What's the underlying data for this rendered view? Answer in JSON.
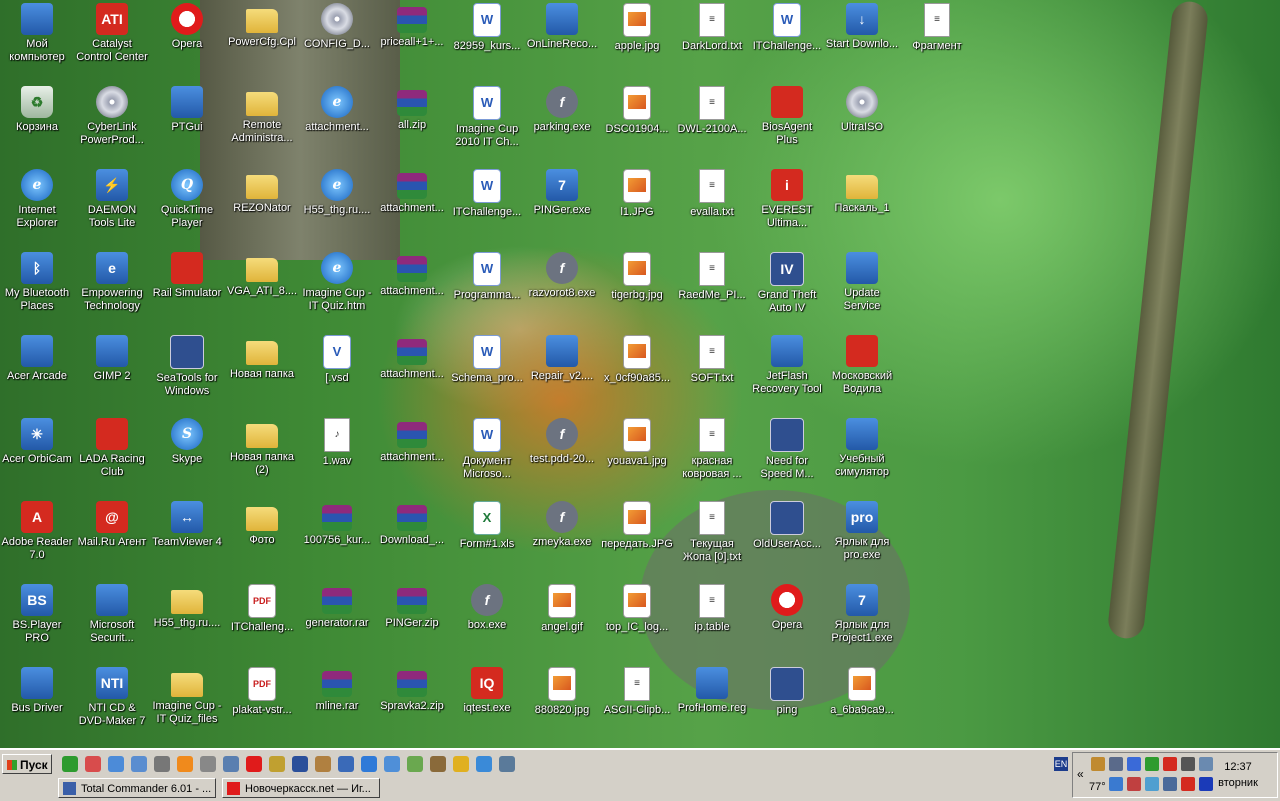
{
  "desktop_icons": [
    {
      "label": "Мой компьютер",
      "icon": "my-computer-icon",
      "kind": "app",
      "col": 0,
      "row": 0
    },
    {
      "label": "Catalyst Control Center",
      "icon": "ati-icon",
      "kind": "red",
      "col": 1,
      "row": 0,
      "glyph": "ATI"
    },
    {
      "label": "Opera",
      "icon": "opera-icon",
      "kind": "opera",
      "col": 2,
      "row": 0
    },
    {
      "label": "PowerCfg.Cpl",
      "icon": "folder-icon",
      "kind": "folder",
      "col": 3,
      "row": 0
    },
    {
      "label": "CONFIG_D...",
      "icon": "cd-icon",
      "kind": "cd",
      "col": 4,
      "row": 0
    },
    {
      "label": "priceall+1+...",
      "icon": "archive-icon",
      "kind": "zip",
      "col": 5,
      "row": 0
    },
    {
      "label": "82959_kurs...",
      "icon": "word-document-icon",
      "kind": "word",
      "col": 6,
      "row": 0,
      "glyph": "W"
    },
    {
      "label": "OnLineReco...",
      "icon": "app-icon",
      "kind": "app",
      "col": 7,
      "row": 0
    },
    {
      "label": "apple.jpg",
      "icon": "image-file-icon",
      "kind": "img",
      "col": 8,
      "row": 0
    },
    {
      "label": "DarkLord.txt",
      "icon": "text-file-icon",
      "kind": "doc",
      "col": 9,
      "row": 0,
      "glyph": "≡"
    },
    {
      "label": "ITChallenge...",
      "icon": "word-document-icon",
      "kind": "word",
      "col": 10,
      "row": 0,
      "glyph": "W"
    },
    {
      "label": "Start Downlo...",
      "icon": "download-icon",
      "kind": "app",
      "col": 11,
      "row": 0,
      "glyph": "↓"
    },
    {
      "label": "Фрагмент",
      "icon": "text-file-icon",
      "kind": "doc",
      "col": 12,
      "row": 0,
      "glyph": "≡"
    },
    {
      "label": "Корзина",
      "icon": "recycle-bin-icon",
      "kind": "recycle",
      "col": 0,
      "row": 1,
      "glyph": "♻"
    },
    {
      "label": "CyberLink PowerProd...",
      "icon": "cd-icon",
      "kind": "cd",
      "col": 1,
      "row": 1
    },
    {
      "label": "PTGui",
      "icon": "app-icon",
      "kind": "app",
      "col": 2,
      "row": 1
    },
    {
      "label": "Remote Administra...",
      "icon": "folder-icon",
      "kind": "folder",
      "col": 3,
      "row": 1
    },
    {
      "label": "attachment...",
      "icon": "internet-explorer-icon",
      "kind": "ie",
      "col": 4,
      "row": 1,
      "glyph": "e"
    },
    {
      "label": "all.zip",
      "icon": "archive-icon",
      "kind": "zip",
      "col": 5,
      "row": 1
    },
    {
      "label": "Imagine Cup 2010 IT Ch...",
      "icon": "word-document-icon",
      "kind": "word",
      "col": 6,
      "row": 1,
      "glyph": "W"
    },
    {
      "label": "parking.exe",
      "icon": "flash-icon",
      "kind": "flash",
      "col": 7,
      "row": 1,
      "glyph": "f"
    },
    {
      "label": "DSC01904...",
      "icon": "image-file-icon",
      "kind": "img",
      "col": 8,
      "row": 1
    },
    {
      "label": "DWL-2100A...",
      "icon": "text-file-icon",
      "kind": "doc",
      "col": 9,
      "row": 1,
      "glyph": "≡"
    },
    {
      "label": "BiosAgent Plus",
      "icon": "app-icon",
      "kind": "red",
      "col": 10,
      "row": 1
    },
    {
      "label": "UltraISO",
      "icon": "cd-icon",
      "kind": "cd",
      "col": 11,
      "row": 1
    },
    {
      "label": "Internet Explorer",
      "icon": "internet-explorer-icon",
      "kind": "ie",
      "col": 0,
      "row": 2,
      "glyph": "e"
    },
    {
      "label": "DAEMON Tools Lite",
      "icon": "daemon-tools-icon",
      "kind": "app",
      "col": 1,
      "row": 2,
      "glyph": "⚡"
    },
    {
      "label": "QuickTime Player",
      "icon": "quicktime-icon",
      "kind": "ie",
      "col": 2,
      "row": 2,
      "glyph": "Q"
    },
    {
      "label": "REZONator",
      "icon": "folder-icon",
      "kind": "folder",
      "col": 3,
      "row": 2
    },
    {
      "label": "H55_thg.ru....",
      "icon": "internet-explorer-icon",
      "kind": "ie",
      "col": 4,
      "row": 2,
      "glyph": "e"
    },
    {
      "label": "attachment...",
      "icon": "archive-icon",
      "kind": "zip",
      "col": 5,
      "row": 2
    },
    {
      "label": "ITChallenge...",
      "icon": "word-document-icon",
      "kind": "word",
      "col": 6,
      "row": 2,
      "glyph": "W"
    },
    {
      "label": "PINGer.exe",
      "icon": "app-icon",
      "kind": "app",
      "col": 7,
      "row": 2,
      "glyph": "7"
    },
    {
      "label": "l1.JPG",
      "icon": "image-file-icon",
      "kind": "img",
      "col": 8,
      "row": 2
    },
    {
      "label": "evalla.txt",
      "icon": "text-file-icon",
      "kind": "doc",
      "col": 9,
      "row": 2,
      "glyph": "≡"
    },
    {
      "label": "EVEREST Ultima...",
      "icon": "info-icon",
      "kind": "red",
      "col": 10,
      "row": 2,
      "glyph": "i"
    },
    {
      "label": "Паскаль_1",
      "icon": "folder-icon",
      "kind": "folder",
      "col": 11,
      "row": 2
    },
    {
      "label": "My Bluetooth Places",
      "icon": "bluetooth-icon",
      "kind": "app",
      "col": 0,
      "row": 3,
      "glyph": "ᛒ"
    },
    {
      "label": "Empowering Technology",
      "icon": "app-icon",
      "kind": "app",
      "col": 1,
      "row": 3,
      "glyph": "e"
    },
    {
      "label": "Rail Simulator",
      "icon": "app-icon",
      "kind": "red",
      "col": 2,
      "row": 3
    },
    {
      "label": "VGA_ATI_8....",
      "icon": "folder-icon",
      "kind": "folder",
      "col": 3,
      "row": 3
    },
    {
      "label": "Imagine Cup - IT Quiz.htm",
      "icon": "internet-explorer-icon",
      "kind": "ie",
      "col": 4,
      "row": 3,
      "glyph": "e"
    },
    {
      "label": "attachment...",
      "icon": "archive-icon",
      "kind": "zip",
      "col": 5,
      "row": 3
    },
    {
      "label": "Programma...",
      "icon": "word-document-icon",
      "kind": "word",
      "col": 6,
      "row": 3,
      "glyph": "W"
    },
    {
      "label": "razvorot8.exe",
      "icon": "flash-icon",
      "kind": "flash",
      "col": 7,
      "row": 3,
      "glyph": "f"
    },
    {
      "label": "tigerbg.jpg",
      "icon": "image-file-icon",
      "kind": "img",
      "col": 8,
      "row": 3
    },
    {
      "label": "RaedMe_PI...",
      "icon": "text-file-icon",
      "kind": "doc",
      "col": 9,
      "row": 3,
      "glyph": "≡"
    },
    {
      "label": "Grand Theft Auto IV",
      "icon": "gta-icon",
      "kind": "win",
      "col": 10,
      "row": 3,
      "glyph": "IV"
    },
    {
      "label": "Update Service",
      "icon": "app-icon",
      "kind": "app",
      "col": 11,
      "row": 3
    },
    {
      "label": "Acer Arcade",
      "icon": "app-icon",
      "kind": "app",
      "col": 0,
      "row": 4
    },
    {
      "label": "GIMP 2",
      "icon": "gimp-icon",
      "kind": "app",
      "col": 1,
      "row": 4
    },
    {
      "label": "SeaTools for Windows",
      "icon": "app-icon",
      "kind": "win",
      "col": 2,
      "row": 4
    },
    {
      "label": "Новая папка",
      "icon": "folder-icon",
      "kind": "folder",
      "col": 3,
      "row": 4
    },
    {
      "label": "[.vsd",
      "icon": "visio-file-icon",
      "kind": "word",
      "col": 4,
      "row": 4,
      "glyph": "V"
    },
    {
      "label": "attachment...",
      "icon": "archive-icon",
      "kind": "zip",
      "col": 5,
      "row": 4
    },
    {
      "label": "Schema_pro...",
      "icon": "word-document-icon",
      "kind": "word",
      "col": 6,
      "row": 4,
      "glyph": "W"
    },
    {
      "label": "Repair_v2....",
      "icon": "app-icon",
      "kind": "app",
      "col": 7,
      "row": 4
    },
    {
      "label": "x_0cf90a85...",
      "icon": "image-file-icon",
      "kind": "img",
      "col": 8,
      "row": 4
    },
    {
      "label": "SOFT.txt",
      "icon": "text-file-icon",
      "kind": "doc",
      "col": 9,
      "row": 4,
      "glyph": "≡"
    },
    {
      "label": "JetFlash Recovery Tool",
      "icon": "app-icon",
      "kind": "app",
      "col": 10,
      "row": 4
    },
    {
      "label": "Московский Водила",
      "icon": "car-icon",
      "kind": "red",
      "col": 11,
      "row": 4
    },
    {
      "label": "Acer OrbiCam",
      "icon": "app-icon",
      "kind": "app",
      "col": 0,
      "row": 5,
      "glyph": "✳"
    },
    {
      "label": "LADA Racing Club",
      "icon": "app-icon",
      "kind": "red",
      "col": 1,
      "row": 5
    },
    {
      "label": "Skype",
      "icon": "skype-icon",
      "kind": "ie",
      "col": 2,
      "row": 5,
      "glyph": "S"
    },
    {
      "label": "Новая папка (2)",
      "icon": "folder-icon",
      "kind": "folder",
      "col": 3,
      "row": 5
    },
    {
      "label": "1.wav",
      "icon": "audio-file-icon",
      "kind": "doc",
      "col": 4,
      "row": 5,
      "glyph": "♪"
    },
    {
      "label": "attachment...",
      "icon": "archive-icon",
      "kind": "zip",
      "col": 5,
      "row": 5
    },
    {
      "label": "Документ Microso...",
      "icon": "word-document-icon",
      "kind": "word",
      "col": 6,
      "row": 5,
      "glyph": "W"
    },
    {
      "label": "test.pdd-20...",
      "icon": "flash-icon",
      "kind": "flash",
      "col": 7,
      "row": 5,
      "glyph": "f"
    },
    {
      "label": "youava1.jpg",
      "icon": "image-file-icon",
      "kind": "img",
      "col": 8,
      "row": 5
    },
    {
      "label": "красная ковровая ...",
      "icon": "text-file-icon",
      "kind": "doc",
      "col": 9,
      "row": 5,
      "glyph": "≡"
    },
    {
      "label": "Need for Speed M...",
      "icon": "app-icon",
      "kind": "win",
      "col": 10,
      "row": 5
    },
    {
      "label": "Учебный симулятор",
      "icon": "app-icon",
      "kind": "app",
      "col": 11,
      "row": 5
    },
    {
      "label": "Adobe Reader 7.0",
      "icon": "adobe-reader-icon",
      "kind": "red",
      "col": 0,
      "row": 6,
      "glyph": "A"
    },
    {
      "label": "Mail.Ru Агент",
      "icon": "mail-agent-icon",
      "kind": "red",
      "col": 1,
      "row": 6,
      "glyph": "@"
    },
    {
      "label": "TeamViewer 4",
      "icon": "teamviewer-icon",
      "kind": "app",
      "col": 2,
      "row": 6,
      "glyph": "↔"
    },
    {
      "label": "Фото",
      "icon": "folder-icon",
      "kind": "folder",
      "col": 3,
      "row": 6
    },
    {
      "label": "100756_kur...",
      "icon": "archive-icon",
      "kind": "zip",
      "col": 4,
      "row": 6
    },
    {
      "label": "Download_...",
      "icon": "archive-icon",
      "kind": "zip",
      "col": 5,
      "row": 6
    },
    {
      "label": "Form#1.xls",
      "icon": "excel-file-icon",
      "kind": "xls",
      "col": 6,
      "row": 6,
      "glyph": "X"
    },
    {
      "label": "zmeyka.exe",
      "icon": "flash-icon",
      "kind": "flash",
      "col": 7,
      "row": 6,
      "glyph": "f"
    },
    {
      "label": "передать.JPG",
      "icon": "image-file-icon",
      "kind": "img",
      "col": 8,
      "row": 6
    },
    {
      "label": "Текущая Жопа [0].txt",
      "icon": "text-file-icon",
      "kind": "doc",
      "col": 9,
      "row": 6,
      "glyph": "≡"
    },
    {
      "label": "OldUserAcc...",
      "icon": "window-icon",
      "kind": "win",
      "col": 10,
      "row": 6
    },
    {
      "label": "Ярлык для pro.exe",
      "icon": "app-icon",
      "kind": "app",
      "col": 11,
      "row": 6,
      "glyph": "pro"
    },
    {
      "label": "BS.Player PRO",
      "icon": "bsplayer-icon",
      "kind": "app",
      "col": 0,
      "row": 7,
      "glyph": "BS"
    },
    {
      "label": "Microsoft Securit...",
      "icon": "app-icon",
      "kind": "app",
      "col": 1,
      "row": 7
    },
    {
      "label": "H55_thg.ru....",
      "icon": "folder-icon",
      "kind": "folder",
      "col": 2,
      "row": 7
    },
    {
      "label": "ITChalleng...",
      "icon": "pdf-file-icon",
      "kind": "pdf",
      "col": 3,
      "row": 7,
      "glyph": "PDF"
    },
    {
      "label": "generator.rar",
      "icon": "archive-icon",
      "kind": "zip",
      "col": 4,
      "row": 7
    },
    {
      "label": "PINGer.zip",
      "icon": "archive-icon",
      "kind": "zip",
      "col": 5,
      "row": 7
    },
    {
      "label": "box.exe",
      "icon": "flash-icon",
      "kind": "flash",
      "col": 6,
      "row": 7,
      "glyph": "f"
    },
    {
      "label": "angel.gif",
      "icon": "image-file-icon",
      "kind": "img",
      "col": 7,
      "row": 7
    },
    {
      "label": "top_IC_log...",
      "icon": "image-file-icon",
      "kind": "img",
      "col": 8,
      "row": 7
    },
    {
      "label": "ip.table",
      "icon": "text-file-icon",
      "kind": "doc",
      "col": 9,
      "row": 7,
      "glyph": "≡"
    },
    {
      "label": "Opera",
      "icon": "opera-icon",
      "kind": "opera",
      "col": 10,
      "row": 7
    },
    {
      "label": "Ярлык для Project1.exe",
      "icon": "app-icon",
      "kind": "app",
      "col": 11,
      "row": 7,
      "glyph": "7"
    },
    {
      "label": "Bus Driver",
      "icon": "bus-icon",
      "kind": "app",
      "col": 0,
      "row": 8
    },
    {
      "label": "NTI CD & DVD-Maker 7",
      "icon": "app-icon",
      "kind": "app",
      "col": 1,
      "row": 8,
      "glyph": "NTI"
    },
    {
      "label": "Imagine Cup - IT Quiz_files",
      "icon": "folder-icon",
      "kind": "folder",
      "col": 2,
      "row": 8
    },
    {
      "label": "plakat-vstr...",
      "icon": "pdf-file-icon",
      "kind": "pdf",
      "col": 3,
      "row": 8,
      "glyph": "PDF"
    },
    {
      "label": "mline.rar",
      "icon": "archive-icon",
      "kind": "zip",
      "col": 4,
      "row": 8
    },
    {
      "label": "Spravka2.zip",
      "icon": "archive-icon",
      "kind": "zip",
      "col": 5,
      "row": 8
    },
    {
      "label": "iqtest.exe",
      "icon": "iq-icon",
      "kind": "red",
      "col": 6,
      "row": 8,
      "glyph": "IQ"
    },
    {
      "label": "880820.jpg",
      "icon": "image-file-icon",
      "kind": "img",
      "col": 7,
      "row": 8
    },
    {
      "label": "ASCII-Clipb...",
      "icon": "text-file-icon",
      "kind": "doc",
      "col": 8,
      "row": 8,
      "glyph": "≡"
    },
    {
      "label": "ProfHome.reg",
      "icon": "registry-file-icon",
      "kind": "app",
      "col": 9,
      "row": 8
    },
    {
      "label": "ping",
      "icon": "window-icon",
      "kind": "win",
      "col": 10,
      "row": 8
    },
    {
      "label": "a_6ba9ca9...",
      "icon": "image-file-icon",
      "kind": "img",
      "col": 11,
      "row": 8
    }
  ],
  "taskbar": {
    "start_label": "Пуск",
    "quick_launch": [
      {
        "icon": "green-app-icon",
        "color": "#2e9b2e"
      },
      {
        "icon": "plus-icon",
        "color": "#d84c4c"
      },
      {
        "icon": "globe-icon",
        "color": "#4c8bd8"
      },
      {
        "icon": "chat-icon",
        "color": "#5a8dd0"
      },
      {
        "icon": "cat-icon",
        "color": "#777777"
      },
      {
        "icon": "mail-icon",
        "color": "#f08a1c"
      },
      {
        "icon": "calculator-icon",
        "color": "#888888"
      },
      {
        "icon": "person-icon",
        "color": "#5a7fb0"
      },
      {
        "icon": "opera-icon",
        "color": "#e01b1b"
      },
      {
        "icon": "tool-icon",
        "color": "#c0a030"
      },
      {
        "icon": "save-icon",
        "color": "#2a4f9a"
      },
      {
        "icon": "pen-icon",
        "color": "#b08040"
      },
      {
        "icon": "media-icon",
        "color": "#3a6ab8"
      },
      {
        "icon": "ie-icon",
        "color": "#2f7ad8"
      },
      {
        "icon": "document-icon",
        "color": "#4f8fd8"
      },
      {
        "icon": "gear-icon",
        "color": "#6aa84f"
      },
      {
        "icon": "star-icon",
        "color": "#8a6a3a"
      },
      {
        "icon": "clock-icon",
        "color": "#e0b020"
      },
      {
        "icon": "quicktime-icon",
        "color": "#3a8ad8"
      },
      {
        "icon": "network-icon",
        "color": "#5a7a9a"
      }
    ],
    "tasks": [
      {
        "label": "Total Commander 6.01 - ...",
        "icon": "total-commander-icon",
        "color": "#3a5fa8"
      },
      {
        "label": "Новочеркасск.net — Иг...",
        "icon": "opera-icon",
        "color": "#e01b1b"
      }
    ],
    "language": "EN",
    "tray_temp": "77°",
    "clock_time": "12:37",
    "clock_day": "вторник",
    "tray_icons": [
      {
        "icon": "network-icon",
        "color": "#c08a30"
      },
      {
        "icon": "monitor-icon",
        "color": "#5a6a8a"
      },
      {
        "icon": "bluetooth-icon",
        "color": "#3a6ad8"
      },
      {
        "icon": "green-icon",
        "color": "#2e9b2e"
      },
      {
        "icon": "ati-icon",
        "color": "#d42a1f"
      },
      {
        "icon": "battery-icon",
        "color": "#555555"
      },
      {
        "icon": "speaker-icon",
        "color": "#6a8ab0"
      },
      {
        "icon": "antivirus-icon",
        "color": "#3a7ad0"
      },
      {
        "icon": "shield-icon",
        "color": "#c04040"
      },
      {
        "icon": "mail-icon",
        "color": "#4f9fd0"
      },
      {
        "icon": "monitor-icon",
        "color": "#4a6a9a"
      },
      {
        "icon": "opera-icon",
        "color": "#d42a1f"
      },
      {
        "icon": "bluetooth-icon",
        "color": "#1a3ab8"
      }
    ]
  }
}
